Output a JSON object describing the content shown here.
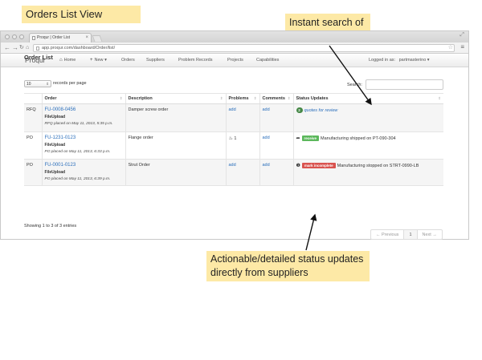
{
  "slide_title": "Orders List View",
  "callouts": {
    "search": "Instant search of any order detail",
    "status": "Actionable/detailed status updates directly from suppliers"
  },
  "browser": {
    "tab_title": "Proqur | Order List",
    "url": "app.proqur.com/dashboard/Order/list/"
  },
  "navbar": {
    "brand": "Proqur",
    "items": [
      {
        "label": "Home",
        "icon": "home-icon"
      },
      {
        "label": "New",
        "icon": "plus-icon"
      },
      {
        "label": "Orders"
      },
      {
        "label": "Suppliers"
      },
      {
        "label": "Problem Records"
      },
      {
        "label": "Projects"
      },
      {
        "label": "Capabilities"
      }
    ],
    "logged_in_label": "Logged in as:",
    "username": "partmasterino"
  },
  "page_title": "Order List",
  "controls": {
    "page_length": "10",
    "page_length_label": "records per page",
    "search_label": "Search:",
    "search_value": ""
  },
  "table": {
    "columns": [
      "",
      "Order",
      "Description",
      "Problems",
      "Comments",
      "Status Updates"
    ],
    "rows": [
      {
        "type": "RFQ",
        "order_id": "FU-0008-0456",
        "file": "FileUpload",
        "placed": "RFQ placed on May 11, 2013, 5:35 p.m.",
        "description": "Damper screw order",
        "problems": "add",
        "comments": "add",
        "status_count": "2",
        "status_text": "quotes for review"
      },
      {
        "type": "PO",
        "order_id": "FU-1231-0123",
        "file": "FileUpload",
        "placed": "PO placed on May 11, 2013, 6:33 p.m.",
        "description": "Flange order",
        "problems": "1",
        "problems_icon": "fire-icon",
        "comments": "add",
        "status_icon": "share-arrow-icon",
        "status_label": "receive",
        "status_text": "Manufacturing shipped on PT-090-304"
      },
      {
        "type": "PO",
        "order_id": "FU-0001-0123",
        "file": "FileUpload",
        "placed": "PO placed on May 11, 2013, 6:39 p.m.",
        "description": "Strut Order",
        "problems": "add",
        "comments": "add",
        "status_icon": "alert-circle-icon",
        "status_label": "mark incomplete",
        "status_text": "Manufacturing stopped on STRT-0990-LB"
      }
    ]
  },
  "footer": {
    "info": "Showing 1 to 3 of 3 entries",
    "prev": "← Previous",
    "page": "1",
    "next": "Next →"
  }
}
